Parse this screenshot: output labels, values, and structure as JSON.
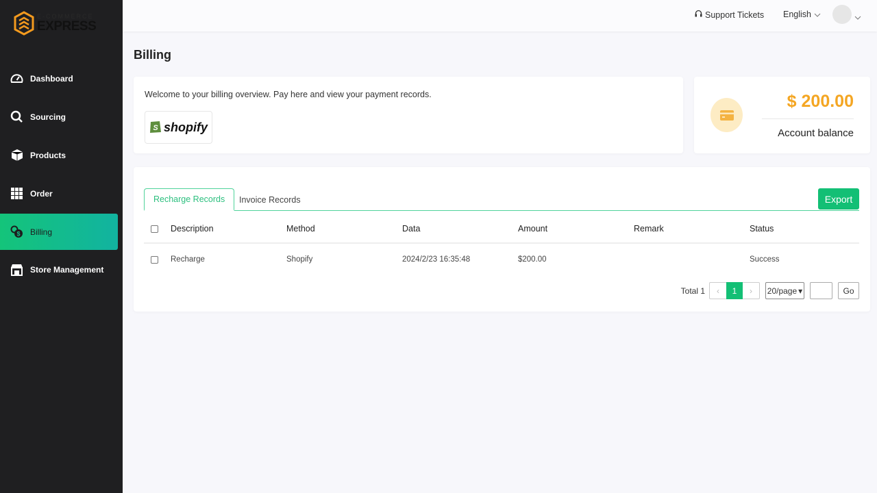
{
  "brand": {
    "line1": "E-COMMERCE",
    "line2": "EXPRESS",
    "accent": "#f39a1e"
  },
  "sidebar": {
    "items": [
      {
        "label": "Dashboard",
        "icon": "speedometer-icon"
      },
      {
        "label": "Sourcing",
        "icon": "search-icon"
      },
      {
        "label": "Products",
        "icon": "box-icon"
      },
      {
        "label": "Order",
        "icon": "grid-icon"
      },
      {
        "label": "Billing",
        "icon": "coins-icon",
        "active": true
      },
      {
        "label": "Store Management",
        "icon": "store-icon"
      }
    ]
  },
  "topbar": {
    "support": "Support Tickets",
    "language": "English"
  },
  "page": {
    "title": "Billing"
  },
  "welcome": {
    "text": "Welcome to your billing overview. Pay here and view your payment records.",
    "shopify": "shopify"
  },
  "balance": {
    "amount": "$ 200.00",
    "label": "Account balance",
    "color": "#f4a623"
  },
  "records": {
    "tabs": [
      "Recharge Records",
      "Invoice Records"
    ],
    "export": "Export",
    "columns": [
      "Description",
      "Method",
      "Data",
      "Amount",
      "Remark",
      "Status"
    ],
    "rows": [
      [
        "Recharge",
        "Shopify",
        "2024/2/23 16:35:48",
        "$200.00",
        "",
        "Success"
      ]
    ],
    "pagination": {
      "total": "Total 1",
      "prev": "‹",
      "current": "1",
      "next": "›",
      "page_size": "20/page",
      "go": "Go"
    }
  }
}
